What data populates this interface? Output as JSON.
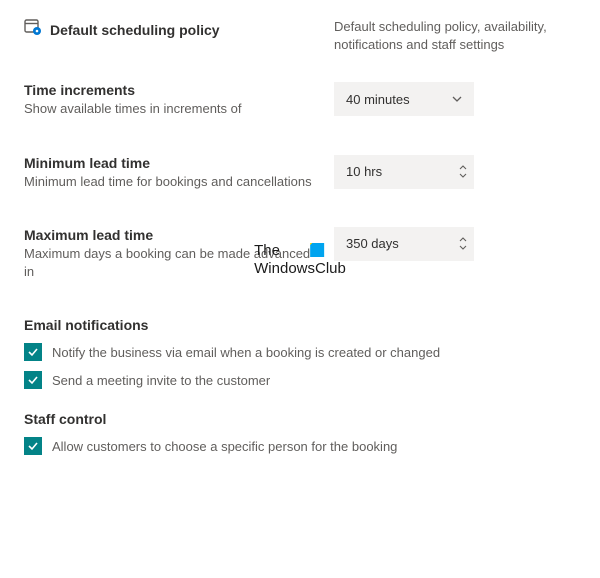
{
  "header": {
    "title": "Default scheduling policy",
    "description": "Default scheduling policy, availability, notifications and staff settings"
  },
  "fields": {
    "time_increments": {
      "label": "Time increments",
      "description": "Show available times in increments of",
      "value": "40 minutes"
    },
    "min_lead": {
      "label": "Minimum lead time",
      "description": "Minimum lead time for bookings and cancellations",
      "value": "10 hrs"
    },
    "max_lead": {
      "label": "Maximum lead time",
      "description": "Maximum days a booking can be made advanced in",
      "value": "350 days"
    }
  },
  "sections": {
    "email_notifications": {
      "heading": "Email notifications",
      "notify_business": "Notify the business via email when a booking is created or changed",
      "send_invite": "Send a meeting invite to the customer"
    },
    "staff_control": {
      "heading": "Staff control",
      "allow_choose": "Allow customers to choose a specific person for the booking"
    }
  },
  "watermark": {
    "line1": "The",
    "line2": "WindowsClub"
  }
}
